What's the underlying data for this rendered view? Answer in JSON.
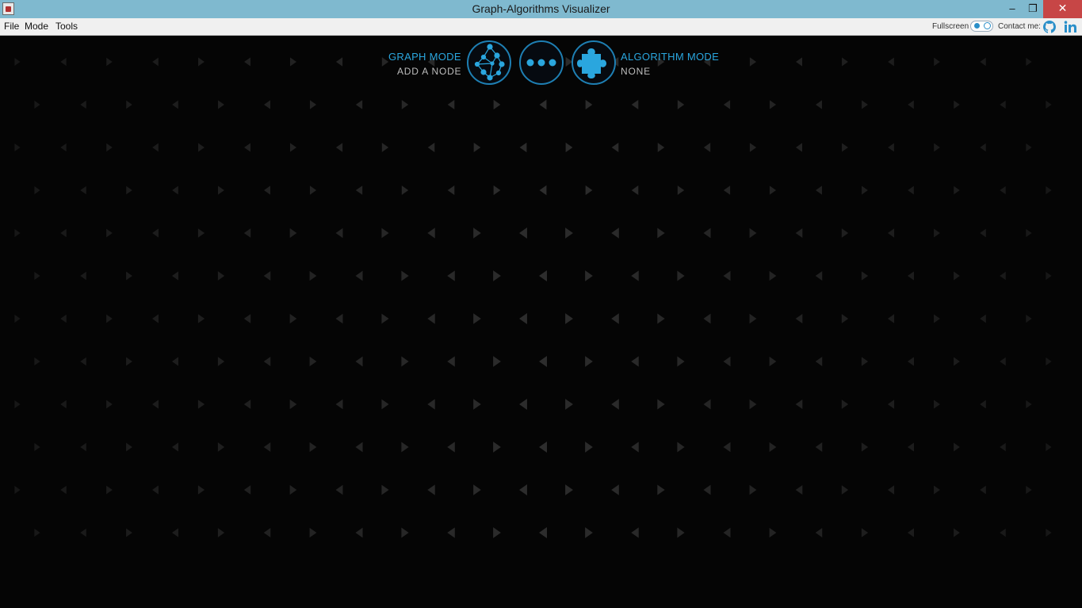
{
  "window": {
    "title": "Graph-Algorithms Visualizer",
    "minimize": "‒",
    "maximize": "❐",
    "close": "✕"
  },
  "menu": {
    "file": "File",
    "mode": "Mode",
    "tools": "Tools",
    "fullscreen_label": "Fullscreen",
    "contact_label": "Contact me:"
  },
  "modes": {
    "graph_mode_title": "GRAPH MODE",
    "graph_mode_sub": "ADD A NODE",
    "algorithm_mode_title": "ALGORITHM MODE",
    "algorithm_mode_sub": "NONE"
  },
  "icons": [
    "app-icon",
    "github-icon",
    "linkedin-icon",
    "graph-network-icon",
    "more-dots-icon",
    "puzzle-icon"
  ],
  "colors": {
    "accent": "#2aa6de",
    "titlebar": "#7fb9cf",
    "background": "#050505",
    "close": "#c74646"
  }
}
